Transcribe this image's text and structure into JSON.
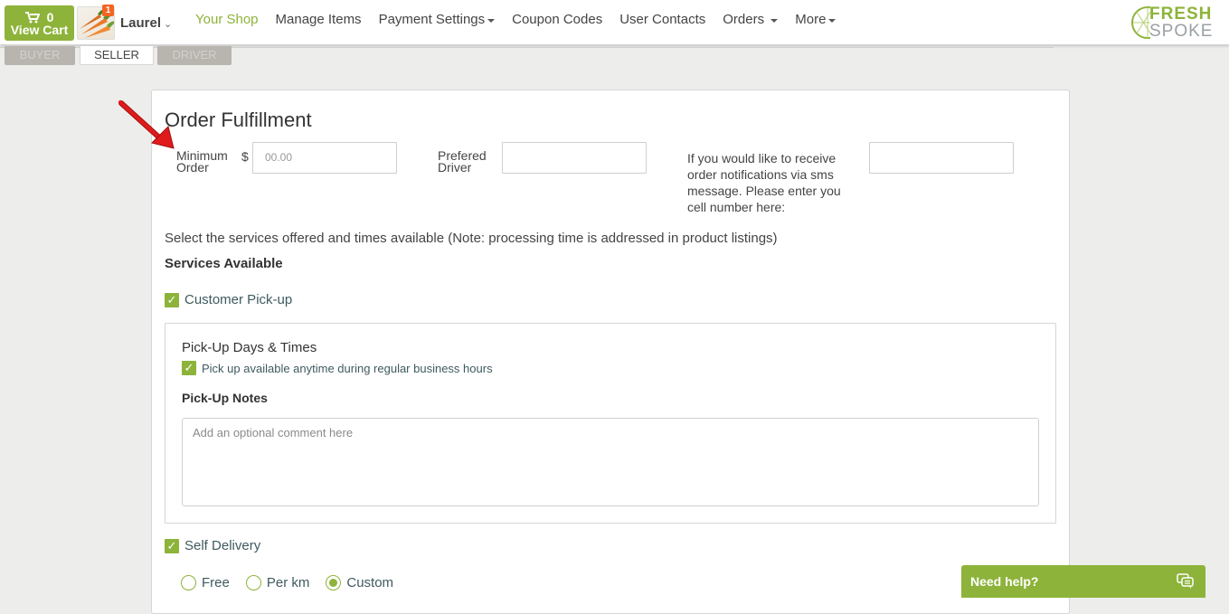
{
  "header": {
    "cart": {
      "count": "0",
      "label": "View Cart"
    },
    "notifications_badge": "1",
    "user_name": "Laurel",
    "nav": [
      {
        "label": "Your Shop",
        "active": true,
        "dropdown": false
      },
      {
        "label": "Manage Items",
        "active": false,
        "dropdown": false
      },
      {
        "label": "Payment Settings",
        "active": false,
        "dropdown": true
      },
      {
        "label": "Coupon Codes",
        "active": false,
        "dropdown": false
      },
      {
        "label": "User Contacts",
        "active": false,
        "dropdown": false
      },
      {
        "label": "Orders",
        "active": false,
        "dropdown": true
      },
      {
        "label": "More",
        "active": false,
        "dropdown": true
      }
    ],
    "logo": {
      "line1": "FRESH",
      "line2": "SPOKE"
    }
  },
  "role_tabs": [
    {
      "label": "BUYER",
      "active": false
    },
    {
      "label": "SELLER",
      "active": true
    },
    {
      "label": "DRIVER",
      "active": false
    }
  ],
  "fulfillment": {
    "title": "Order Fulfillment",
    "min_order": {
      "label_line1": "Minimum",
      "label_line2": "Order",
      "currency": "$",
      "placeholder": "00.00",
      "value": ""
    },
    "preferred_driver": {
      "label_line1": "Prefered",
      "label_line2": "Driver",
      "value": ""
    },
    "sms": {
      "label": "If you would like to receive order notifications via sms message. Please enter you cell number here:",
      "value": ""
    },
    "services_note": "Select the services offered and times available (Note: processing time is addressed in product listings)",
    "services_heading": "Services Available",
    "pickup": {
      "label": "Customer Pick-up",
      "checked": true,
      "days_heading": "Pick-Up Days & Times",
      "anytime_label": "Pick up available anytime during regular business hours",
      "anytime_checked": true,
      "notes_heading": "Pick-Up Notes",
      "notes_placeholder": "Add an optional comment here"
    },
    "self_delivery": {
      "label": "Self Delivery",
      "checked": true,
      "options": [
        {
          "label": "Free",
          "selected": false
        },
        {
          "label": "Per km",
          "selected": false
        },
        {
          "label": "Custom",
          "selected": true
        }
      ]
    }
  },
  "help_widget": {
    "label": "Need help?"
  },
  "colors": {
    "accent": "#8db33a",
    "badge": "#f26522",
    "arrow": "#e01b1b"
  }
}
